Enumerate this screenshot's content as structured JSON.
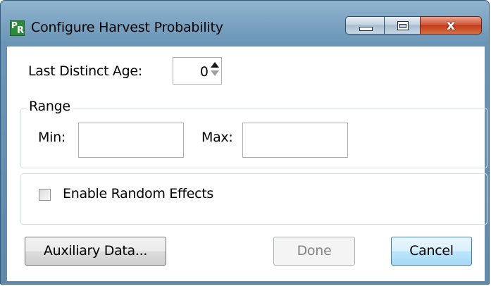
{
  "window": {
    "title": "Configure Harvest Probability",
    "icon_text_top": "P",
    "icon_text_bottom": "R",
    "icon": "app-icon",
    "close_glyph": "x"
  },
  "last_distinct_age": {
    "label": "Last Distinct Age:",
    "value": "0"
  },
  "range": {
    "legend": "Range",
    "min_label": "Min:",
    "min_value": "",
    "max_label": "Max:",
    "max_value": ""
  },
  "random_effects": {
    "label": "Enable Random Effects",
    "checked": false
  },
  "buttons": {
    "auxiliary": "Auxiliary Data...",
    "done": "Done",
    "cancel": "Cancel"
  },
  "colors": {
    "title_bar": "#6b95b6",
    "close_button": "#c23b1c",
    "default_button_border": "#3c7fb1"
  }
}
